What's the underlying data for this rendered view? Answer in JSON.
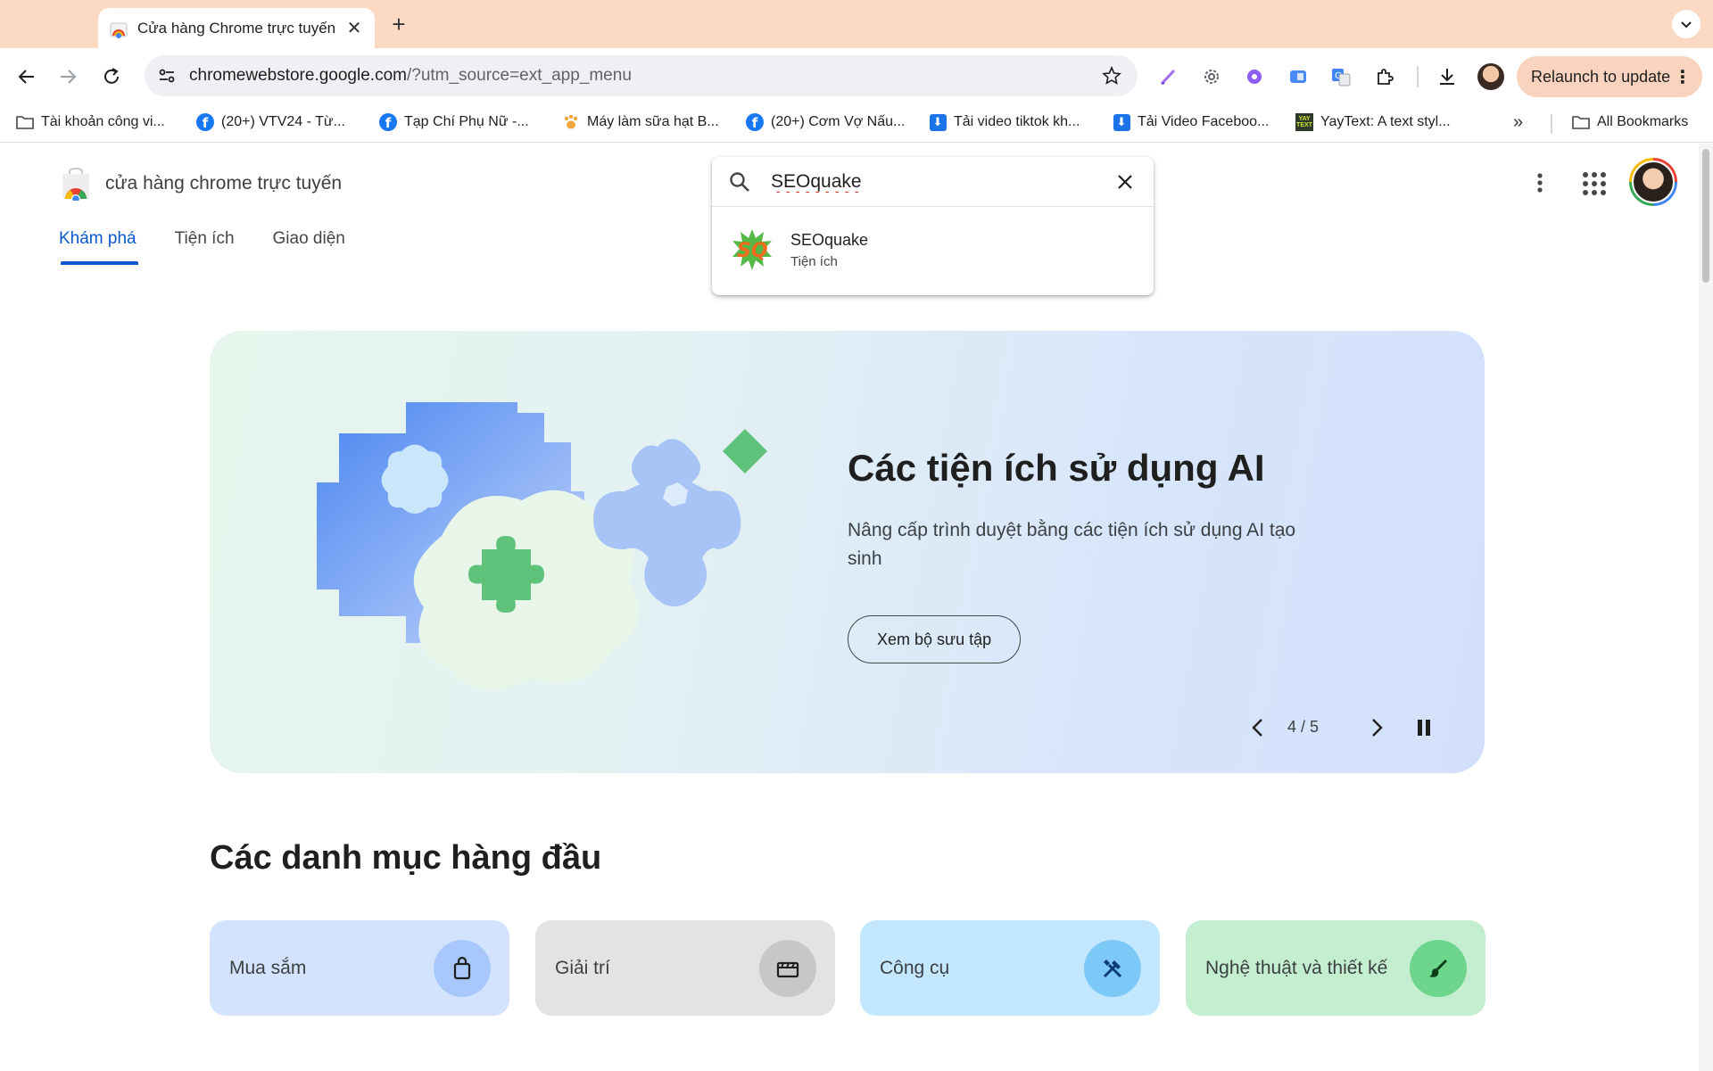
{
  "browser": {
    "tab_title": "Cửa hàng Chrome trực tuyến",
    "url_host": "chromewebstore.google.com",
    "url_path": "/?utm_source=ext_app_menu",
    "relaunch_label": "Relaunch to update",
    "bookmarks": [
      {
        "label": "Tài khoản công vi...",
        "icon": "folder-icon"
      },
      {
        "label": "(20+) VTV24 - Từ...",
        "icon": "facebook-icon"
      },
      {
        "label": "Tạp Chí Phụ Nữ -...",
        "icon": "facebook-icon"
      },
      {
        "label": "Máy làm sữa hạt B...",
        "icon": "paw-icon"
      },
      {
        "label": "(20+) Cơm Vợ Nấu...",
        "icon": "facebook-icon"
      },
      {
        "label": "Tải video tiktok kh...",
        "icon": "download-icon"
      },
      {
        "label": "Tải Video Faceboo...",
        "icon": "download-icon"
      },
      {
        "label": "YayText: A text styl...",
        "icon": "yaytext-icon"
      }
    ],
    "all_bookmarks_label": "All Bookmarks"
  },
  "store": {
    "logo_text": "cửa hàng chrome trực tuyến",
    "tabs": [
      "Khám phá",
      "Tiện ích",
      "Giao diện"
    ],
    "active_tab_index": 0
  },
  "search": {
    "query": "SEOquake",
    "suggestion": {
      "name": "SEOquake",
      "type": "Tiện ích"
    }
  },
  "hero": {
    "title": "Các tiện ích sử dụng AI",
    "description": "Nâng cấp trình duyệt bằng các tiện ích sử dụng AI tạo sinh",
    "button_label": "Xem bộ sưu tập",
    "counter": "4 / 5"
  },
  "categories_section": {
    "title": "Các danh mục hàng đầu",
    "items": [
      {
        "label": "Mua sắm",
        "icon": "shopping-bag-icon",
        "bg": "#d3e3fd",
        "icon_bg": "#a8c7fa"
      },
      {
        "label": "Giải trí",
        "icon": "clapperboard-icon",
        "bg": "#e3e3e3",
        "icon_bg": "#c7c7c7"
      },
      {
        "label": "Công cụ",
        "icon": "tools-icon",
        "bg": "#c2e7ff",
        "icon_bg": "#7cc9f8"
      },
      {
        "label": "Nghệ thuật và thiết kế",
        "icon": "paintbrush-icon",
        "bg": "#c4eed0",
        "icon_bg": "#6dd58c"
      }
    ]
  },
  "colors": {
    "tabbar": "#fbd9c2",
    "accent_blue": "#0b57d0"
  }
}
